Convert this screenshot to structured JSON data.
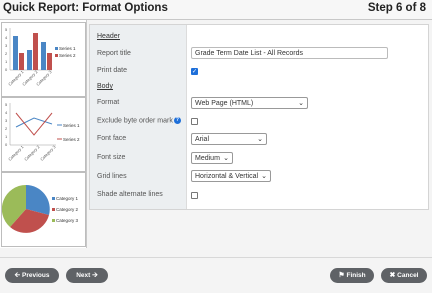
{
  "header": {
    "title": "Quick Report: Format Options",
    "step": "Step 6 of 8"
  },
  "thumbnails": {
    "bar": {
      "yticks": [
        "5",
        "4",
        "3",
        "2",
        "1",
        "0"
      ],
      "categories": [
        "Category 1",
        "Category 2",
        "Category 3"
      ],
      "legend": [
        "Series 1",
        "Series 2"
      ]
    },
    "line": {
      "yticks": [
        "5",
        "4",
        "3",
        "2",
        "1",
        "0"
      ],
      "categories": [
        "Category 1",
        "Category 2",
        "Category 3"
      ],
      "legend": [
        "Series 1",
        "Series 2"
      ]
    },
    "pie": {
      "legend": [
        "Category 1",
        "Category 2",
        "Category 3"
      ]
    }
  },
  "form": {
    "header_section": "Header",
    "report_title_label": "Report title",
    "report_title_value": "Grade Term Date List - All Records",
    "print_date_label": "Print date",
    "print_date_checked": true,
    "body_section": "Body",
    "format_label": "Format",
    "format_value": "Web Page (HTML)",
    "exclude_bom_label": "Exclude byte order mark",
    "exclude_bom_checked": false,
    "font_face_label": "Font face",
    "font_face_value": "Arial",
    "font_size_label": "Font size",
    "font_size_value": "Medium",
    "grid_lines_label": "Grid lines",
    "grid_lines_value": "Horizontal & Vertical",
    "shade_label": "Shade alternate lines",
    "shade_checked": false
  },
  "footer": {
    "previous": "Previous",
    "next": "Next",
    "finish": "Finish",
    "cancel": "Cancel"
  },
  "colors": {
    "series1": "#4a86c5",
    "series2": "#c0504d",
    "series3": "#9bbb59",
    "primary": "#1e6fd9",
    "button": "#5f6266"
  }
}
